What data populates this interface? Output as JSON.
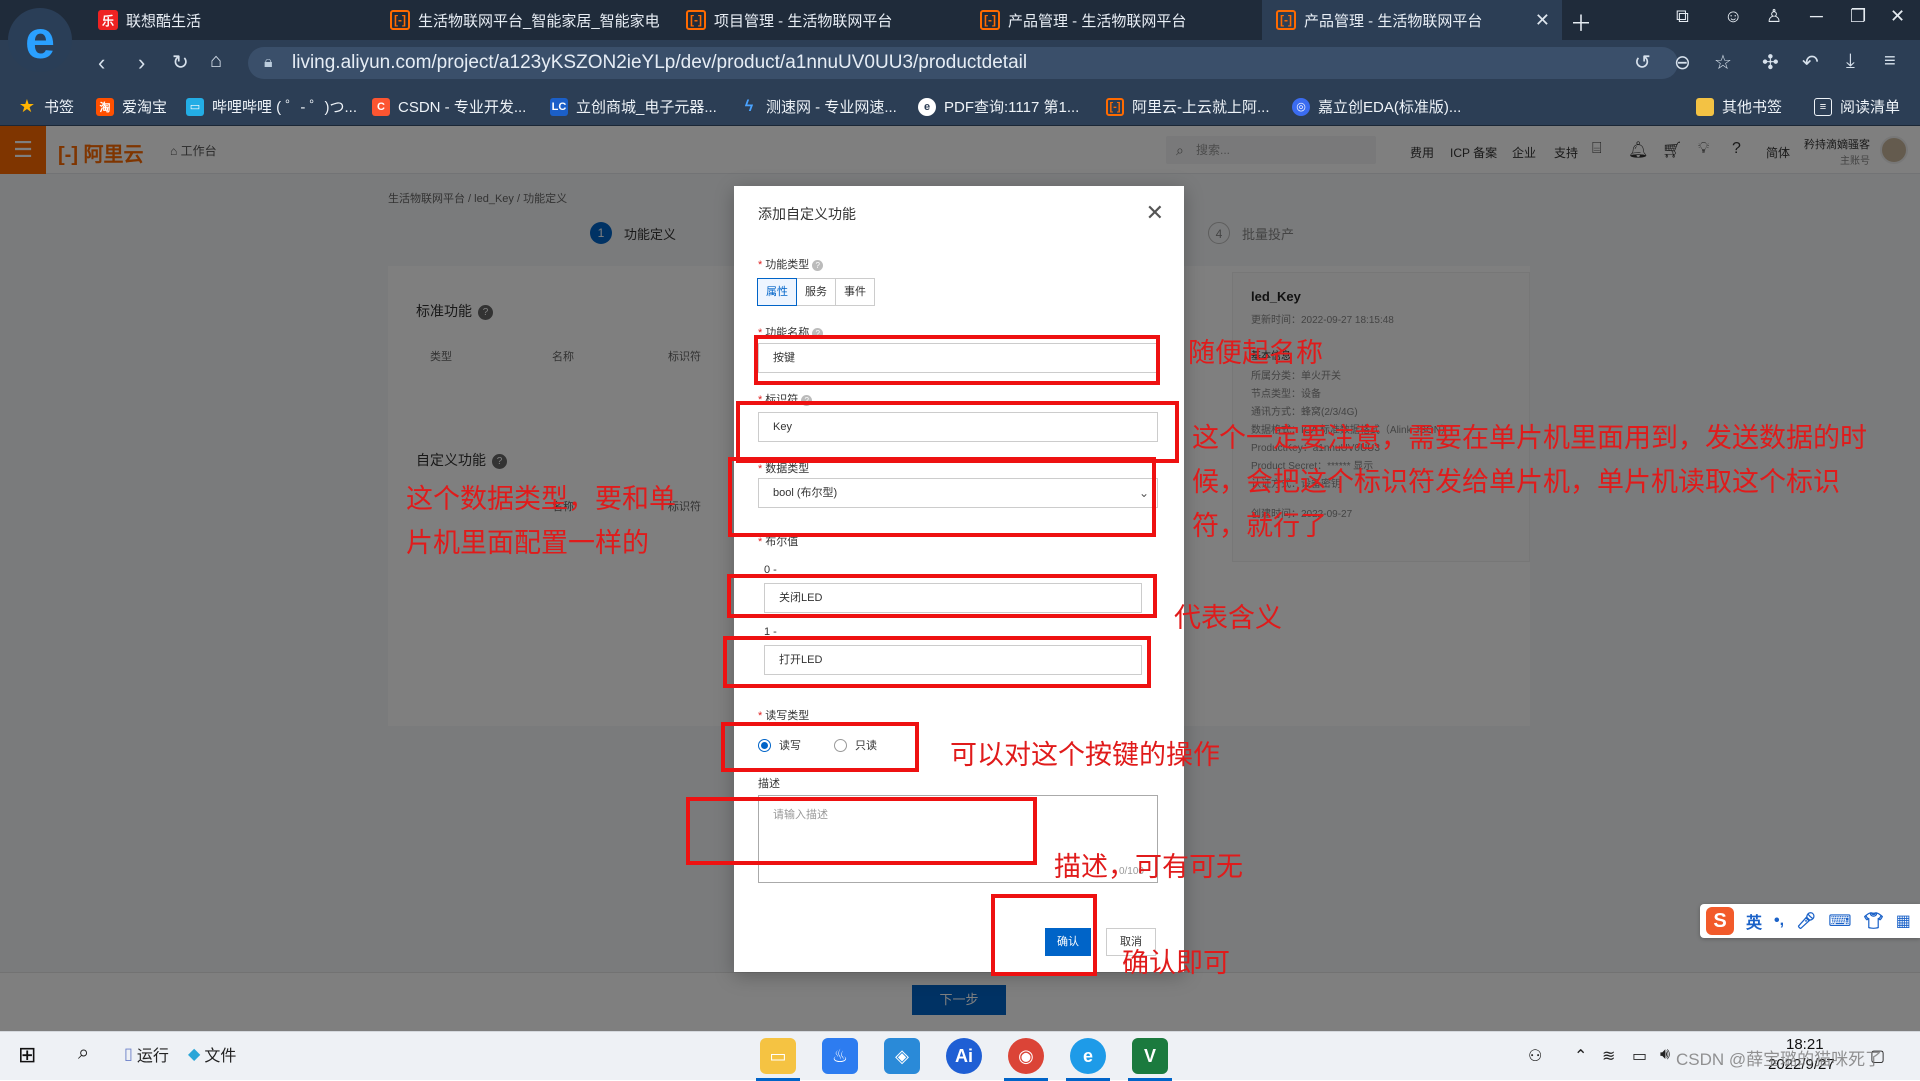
{
  "browser": {
    "tabs": [
      {
        "title": "联想酷生活"
      },
      {
        "title": "生活物联网平台_智能家居_智能家电"
      },
      {
        "title": "项目管理 - 生活物联网平台"
      },
      {
        "title": "产品管理 - 生活物联网平台"
      },
      {
        "title": "产品管理 - 生活物联网平台"
      }
    ],
    "url": "living.aliyun.com/project/a123yKSZON2ieYLp/dev/product/a1nnuUV0UU3/productdetail",
    "bookmarks": [
      {
        "label": "书签"
      },
      {
        "label": "爱淘宝"
      },
      {
        "label": "哔哩哔哩 ( ゜- ゜)つ..."
      },
      {
        "label": "CSDN - 专业开发..."
      },
      {
        "label": "立创商城_电子元器..."
      },
      {
        "label": "测速网 - 专业网速..."
      },
      {
        "label": "PDF查询:1117 第1..."
      },
      {
        "label": "阿里云-上云就上阿..."
      },
      {
        "label": "嘉立创EDA(标准版)..."
      },
      {
        "label": "其他书签"
      },
      {
        "label": "阅读清单"
      }
    ]
  },
  "console": {
    "logo": "阿里云",
    "workbench": "工作台",
    "search_placeholder": "搜索...",
    "nav_links": [
      "费用",
      "ICP 备案",
      "企业",
      "支持",
      "简体"
    ],
    "user_name": "矜持滴嫡骚客",
    "user_sub": "主账号",
    "breadcrumb": "生活物联网平台 / led_Key / 功能定义",
    "steps": [
      {
        "num": "1",
        "label": "功能定义"
      },
      {
        "num": "4",
        "label": "批量投产"
      }
    ],
    "standard_title": "标准功能",
    "standard_headers": [
      "类型",
      "名称",
      "标识符"
    ],
    "custom_title": "自定义功能",
    "custom_headers": [
      "名称",
      "标识符"
    ],
    "info": {
      "title": "led_Key",
      "updated": "更新时间：2022-09-27 18:15:48",
      "lines": [
        "基本信息",
        "所属分类：单火开关",
        "节点类型：设备",
        "通讯方式：蜂窝(2/3/4G)",
        "数据格式：ICA 标准数据格式（Alink JSON）",
        "ProductKey：a1nnuUV0UU3",
        "Product Secret：****** 显示",
        "认证方式：设备密钥",
        "创建时间：2022-09-27"
      ]
    },
    "next_button": "下一步"
  },
  "modal": {
    "title": "添加自定义功能",
    "func_type_label": "功能类型",
    "func_type_options": [
      "属性",
      "服务",
      "事件"
    ],
    "func_type_selected": "属性",
    "name_label": "功能名称",
    "name_value": "按键",
    "identifier_label": "标识符",
    "identifier_value": "Key",
    "datatype_label": "数据类型",
    "datatype_value": "bool (布尔型)",
    "bool_label": "布尔值",
    "bool_0_prefix": "0 -",
    "bool_0_value": "关闭LED",
    "bool_1_prefix": "1 -",
    "bool_1_value": "打开LED",
    "rw_label": "读写类型",
    "rw_options": [
      "读写",
      "只读"
    ],
    "rw_selected": "读写",
    "desc_label": "描述",
    "desc_placeholder": "请输入描述",
    "desc_count": "0/100",
    "ok_button": "确认",
    "cancel_button": "取消"
  },
  "annotations": {
    "name_note": "随便起名称",
    "identifier_note_1": "这个一定要注意，需要在单片机里面用到，发送数据的时",
    "identifier_note_2": "候，会把这个标识符发给单片机，单片机读取这个标识",
    "identifier_note_3": "符，就行了",
    "datatype_note_1": "这个数据类型，要和单",
    "datatype_note_2": "片机里面配置一样的",
    "meaning_note": "代表含义",
    "rw_note": "可以对这个按键的操作",
    "desc_note": "描述，可有可无",
    "ok_note": "确认即可"
  },
  "taskbar": {
    "run_label": "运行",
    "files_label": "文件",
    "ime_lang": "英",
    "clock_time": "18:21",
    "clock_date": "2022/9/27",
    "watermark": "CSDN @薛宝璐的猫咪死了"
  },
  "colors": {
    "accent": "#0064c8",
    "brand": "#ff6a00",
    "annotation": "#e01b1b"
  }
}
